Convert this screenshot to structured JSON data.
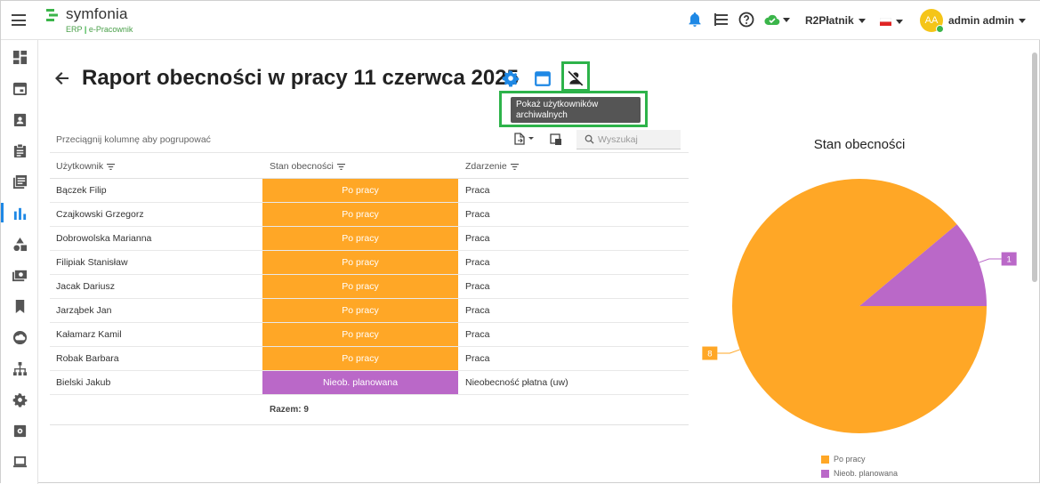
{
  "app": {
    "logo_text": "symfonia",
    "logo_sub_left": "ERP",
    "logo_sub_right": "e-Pracownik",
    "brand_color": "#3bb54a"
  },
  "topbar": {
    "company_selector": "R2Płatnik",
    "user_initials": "AA",
    "user_name": "admin admin",
    "icons": [
      "menu-icon",
      "bell-icon",
      "task-list-icon",
      "help-icon",
      "cloud-check-icon",
      "flag-icon"
    ]
  },
  "sidebar": {
    "items": [
      {
        "icon": "dashboard-icon"
      },
      {
        "icon": "calendar-icon"
      },
      {
        "icon": "badge-icon"
      },
      {
        "icon": "clipboard-icon"
      },
      {
        "icon": "documents-icon"
      },
      {
        "icon": "reports-chart-icon",
        "active": true
      },
      {
        "icon": "shapes-icon"
      },
      {
        "icon": "money-icon"
      },
      {
        "icon": "bookmark-icon"
      },
      {
        "icon": "cloud-icon"
      },
      {
        "icon": "org-chart-icon"
      },
      {
        "icon": "settings-icon"
      },
      {
        "icon": "plugin-icon"
      },
      {
        "icon": "laptop-icon"
      }
    ]
  },
  "page": {
    "title": "Raport obecności w pracy 11 czerwca 2025",
    "tooltip": "Pokaż użytkowników archiwalnych"
  },
  "grid": {
    "group_hint": "Przeciągnij kolumnę aby pogrupować",
    "search_placeholder": "Wyszukaj",
    "columns": [
      "Użytkownik",
      "Stan obecności",
      "Zdarzenie"
    ],
    "rows": [
      {
        "user": "Bączek Filip",
        "status": "Po pracy",
        "event": "Praca"
      },
      {
        "user": "Czajkowski Grzegorz",
        "status": "Po pracy",
        "event": "Praca"
      },
      {
        "user": "Dobrowolska Marianna",
        "status": "Po pracy",
        "event": "Praca"
      },
      {
        "user": "Filipiak Stanisław",
        "status": "Po pracy",
        "event": "Praca"
      },
      {
        "user": "Jacak Dariusz",
        "status": "Po pracy",
        "event": "Praca"
      },
      {
        "user": "Jarząbek Jan",
        "status": "Po pracy",
        "event": "Praca"
      },
      {
        "user": "Kałamarz Kamil",
        "status": "Po pracy",
        "event": "Praca"
      },
      {
        "user": "Robak Barbara",
        "status": "Po pracy",
        "event": "Praca"
      },
      {
        "user": "Bielski Jakub",
        "status": "Nieob. planowana",
        "event": "Nieobecność płatna (uw)"
      }
    ],
    "total": "Razem: 9",
    "status_colors": {
      "Po pracy": "#ffa726",
      "Nieob. planowana": "#ba68c8"
    }
  },
  "chart_data": {
    "type": "pie",
    "title": "Stan obecności",
    "categories": [
      "Po pracy",
      "Nieob. planowana"
    ],
    "values": [
      8,
      1
    ],
    "colors": [
      "#ffa726",
      "#ba68c8"
    ],
    "legend_placement": "bottom"
  }
}
